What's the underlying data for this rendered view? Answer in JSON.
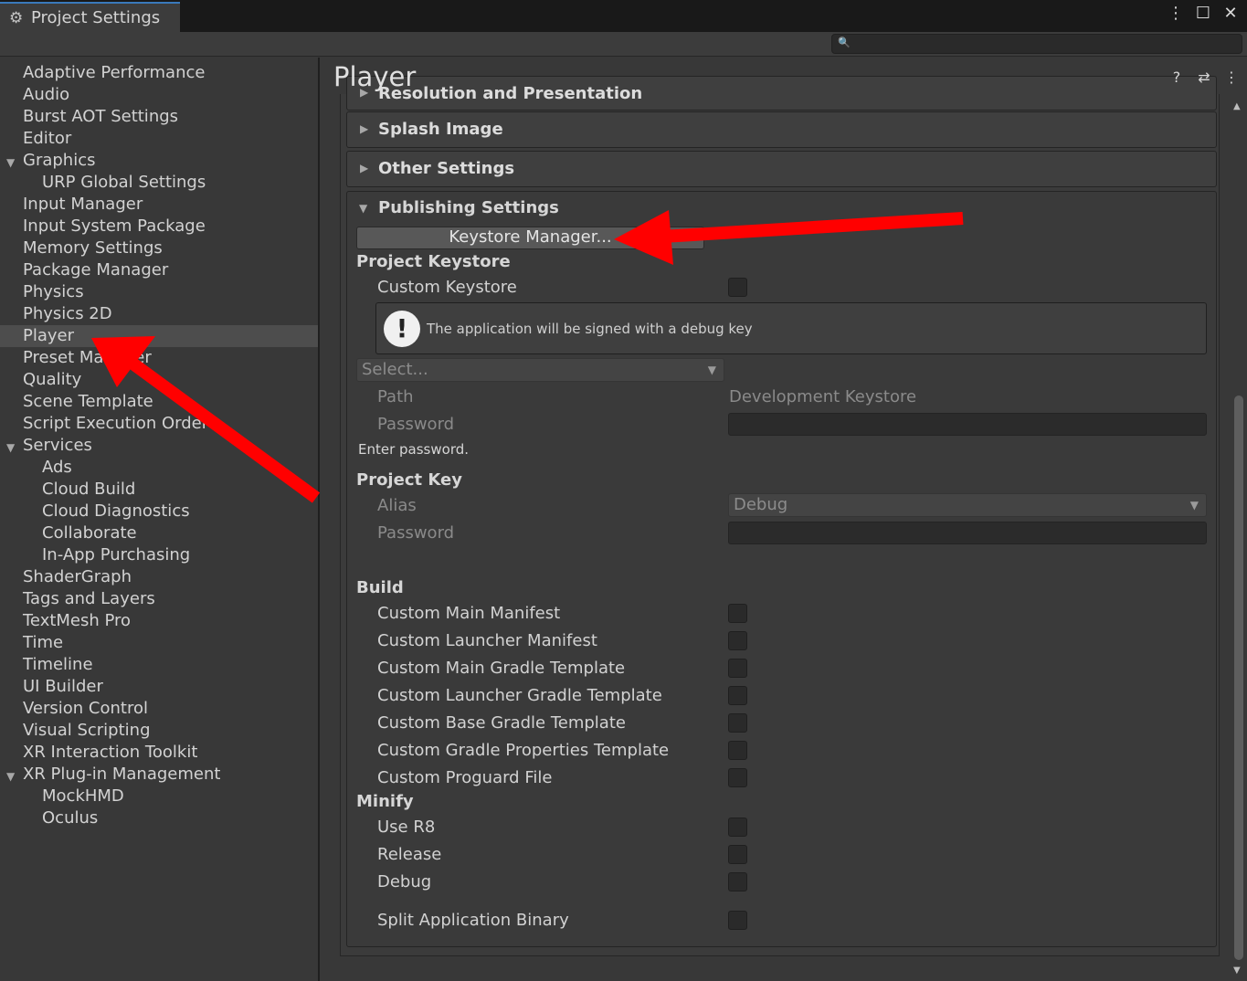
{
  "window": {
    "tab_title": "Project Settings",
    "tab_icon": "gear-icon",
    "menu_icon": "kebab-menu-icon",
    "maximize_icon": "maximize-icon",
    "close_icon": "close-icon",
    "menu_glyph": "⋮",
    "maximize_glyph": "☐",
    "close_glyph": "✕"
  },
  "search": {
    "placeholder": "",
    "value": ""
  },
  "sidebar": {
    "items": [
      {
        "label": "Adaptive Performance"
      },
      {
        "label": "Audio"
      },
      {
        "label": "Burst AOT Settings"
      },
      {
        "label": "Editor"
      },
      {
        "label": "Graphics",
        "expanded": true
      },
      {
        "label": "URP Global Settings",
        "child": true
      },
      {
        "label": "Input Manager"
      },
      {
        "label": "Input System Package"
      },
      {
        "label": "Memory Settings"
      },
      {
        "label": "Package Manager"
      },
      {
        "label": "Physics"
      },
      {
        "label": "Physics 2D"
      },
      {
        "label": "Player",
        "selected": true
      },
      {
        "label": "Preset Manager"
      },
      {
        "label": "Quality"
      },
      {
        "label": "Scene Template"
      },
      {
        "label": "Script Execution Order"
      },
      {
        "label": "Services",
        "expanded": true
      },
      {
        "label": "Ads",
        "child": true
      },
      {
        "label": "Cloud Build",
        "child": true
      },
      {
        "label": "Cloud Diagnostics",
        "child": true
      },
      {
        "label": "Collaborate",
        "child": true
      },
      {
        "label": "In-App Purchasing",
        "child": true
      },
      {
        "label": "ShaderGraph"
      },
      {
        "label": "Tags and Layers"
      },
      {
        "label": "TextMesh Pro"
      },
      {
        "label": "Time"
      },
      {
        "label": "Timeline"
      },
      {
        "label": "UI Builder"
      },
      {
        "label": "Version Control"
      },
      {
        "label": "Visual Scripting"
      },
      {
        "label": "XR Interaction Toolkit"
      },
      {
        "label": "XR Plug-in Management",
        "expanded": true
      },
      {
        "label": "MockHMD",
        "child": true
      },
      {
        "label": "Oculus",
        "child": true
      }
    ]
  },
  "main": {
    "title": "Player",
    "header_icons": [
      "help-icon",
      "presets-icon",
      "kebab-menu-icon"
    ],
    "header_glyphs": [
      "?",
      "⇄",
      "⋮"
    ],
    "sections": {
      "resolution": "Resolution and Presentation",
      "splash": "Splash Image",
      "other": "Other Settings",
      "publishing": "Publishing Settings"
    },
    "publishing": {
      "keystore_manager_button": "Keystore Manager...",
      "project_keystore_header": "Project Keystore",
      "custom_keystore_label": "Custom Keystore",
      "custom_keystore_checked": false,
      "help_text": "The application will be signed with a debug key",
      "keystore_select": "Select...",
      "path_label": "Path",
      "path_value": "Development Keystore",
      "password_label": "Password",
      "password_value": "",
      "enter_password": "Enter password.",
      "project_key_header": "Project Key",
      "alias_label": "Alias",
      "alias_value": "Debug",
      "key_password_label": "Password",
      "key_password_value": "",
      "build_header": "Build",
      "build_options": [
        {
          "label": "Custom Main Manifest",
          "checked": false
        },
        {
          "label": "Custom Launcher Manifest",
          "checked": false
        },
        {
          "label": "Custom Main Gradle Template",
          "checked": false
        },
        {
          "label": "Custom Launcher Gradle Template",
          "checked": false
        },
        {
          "label": "Custom Base Gradle Template",
          "checked": false
        },
        {
          "label": "Custom Gradle Properties Template",
          "checked": false
        },
        {
          "label": "Custom Proguard File",
          "checked": false
        }
      ],
      "minify_header": "Minify",
      "minify_options": [
        {
          "label": "Use R8",
          "checked": false
        },
        {
          "label": "Release",
          "checked": false
        },
        {
          "label": "Debug",
          "checked": false
        }
      ],
      "split_binary_label": "Split Application Binary",
      "split_binary_checked": false
    }
  },
  "annotations": {
    "arrow_color": "#ff0000"
  }
}
